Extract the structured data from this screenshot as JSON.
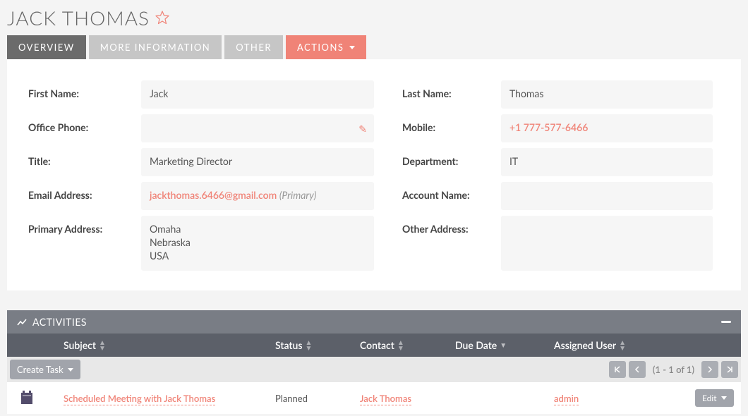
{
  "page_title": "JACK THOMAS",
  "tabs": {
    "overview": "OVERVIEW",
    "more_info": "MORE INFORMATION",
    "other": "OTHER",
    "actions": "ACTIONS"
  },
  "fields": {
    "first_name_label": "First Name:",
    "first_name": "Jack",
    "last_name_label": "Last Name:",
    "last_name": "Thomas",
    "office_phone_label": "Office Phone:",
    "office_phone": "",
    "mobile_label": "Mobile:",
    "mobile": "+1 777-577-6466",
    "title_label": "Title:",
    "title": "Marketing Director",
    "department_label": "Department:",
    "department": "IT",
    "email_label": "Email Address:",
    "email": "jackthomas.6466@gmail.com",
    "email_primary_tag": "(Primary)",
    "account_label": "Account Name:",
    "account": "",
    "primary_addr_label": "Primary Address:",
    "primary_addr_city": "Omaha",
    "primary_addr_state": "Nebraska",
    "primary_addr_country": "USA",
    "other_addr_label": "Other Address:",
    "other_addr": ""
  },
  "activities": {
    "header": "ACTIVITIES",
    "columns": {
      "subject": "Subject",
      "status": "Status",
      "contact": "Contact",
      "due_date": "Due Date",
      "assigned_user": "Assigned User"
    },
    "create_task_label": "Create Task",
    "page_indicator": "(1 - 1 of 1)",
    "row": {
      "subject": "Scheduled Meeting with Jack Thomas",
      "status": "Planned",
      "contact": "Jack Thomas",
      "due_date": "",
      "assigned_user": "admin",
      "edit_label": "Edit"
    }
  }
}
